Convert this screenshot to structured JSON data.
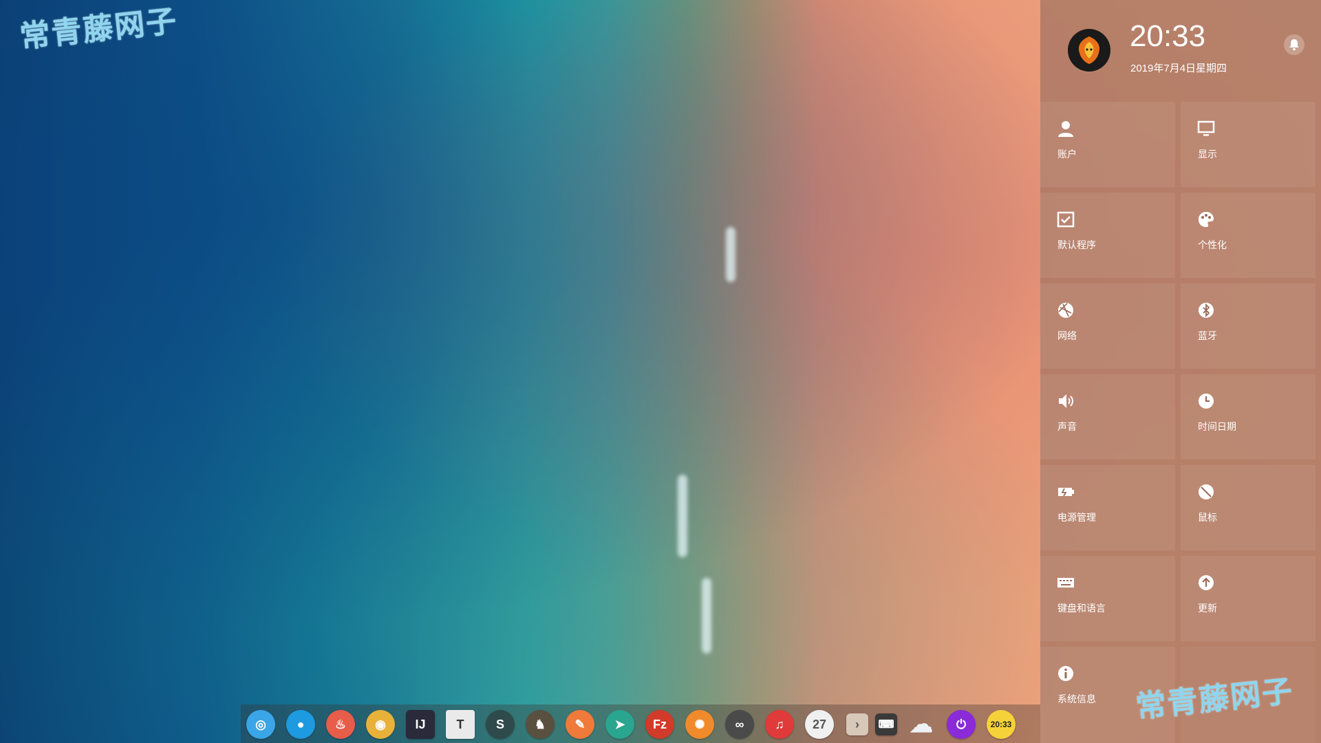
{
  "watermark": {
    "text": "常青藤网子"
  },
  "panel": {
    "clock": "20:33",
    "date": "2019年7月4日星期四",
    "tiles": [
      {
        "label": "账户",
        "icon": "user-icon"
      },
      {
        "label": "显示",
        "icon": "monitor-icon"
      },
      {
        "label": "默认程序",
        "icon": "default-apps-icon"
      },
      {
        "label": "个性化",
        "icon": "palette-icon"
      },
      {
        "label": "网络",
        "icon": "network-icon"
      },
      {
        "label": "蓝牙",
        "icon": "bluetooth-icon"
      },
      {
        "label": "声音",
        "icon": "speaker-icon"
      },
      {
        "label": "时间日期",
        "icon": "clock-icon"
      },
      {
        "label": "电源管理",
        "icon": "battery-icon"
      },
      {
        "label": "鼠标",
        "icon": "mouse-icon"
      },
      {
        "label": "键盘和语言",
        "icon": "keyboard-icon"
      },
      {
        "label": "更新",
        "icon": "update-icon"
      },
      {
        "label": "系统信息",
        "icon": "info-icon"
      }
    ]
  },
  "dock": {
    "items": [
      {
        "name": "launcher-icon",
        "color": "#3aa6e8",
        "glyph": "◎"
      },
      {
        "name": "deepin-store-icon",
        "color": "#1e9be0",
        "glyph": "●"
      },
      {
        "name": "security-icon",
        "color": "#e85c4a",
        "glyph": "♨"
      },
      {
        "name": "chrome-icon",
        "color": "#e8b23a",
        "glyph": "◉"
      },
      {
        "name": "intellij-icon",
        "color": "#2a2a3a",
        "glyph": "IJ"
      },
      {
        "name": "typora-icon",
        "color": "#eaeaea",
        "glyph": "T"
      },
      {
        "name": "s-app-icon",
        "color": "#2f4a4a",
        "glyph": "S"
      },
      {
        "name": "penguin-icon",
        "color": "#5a5040",
        "glyph": "♞"
      },
      {
        "name": "edit-tool-icon",
        "color": "#f07a3a",
        "glyph": "✎"
      },
      {
        "name": "telegram-icon",
        "color": "#2aa58f",
        "glyph": "➤"
      },
      {
        "name": "filezilla-icon",
        "color": "#d23a2a",
        "glyph": "Fz"
      },
      {
        "name": "settings-app-icon",
        "color": "#f08a2a",
        "glyph": "✺"
      },
      {
        "name": "infinity-app-icon",
        "color": "#4a4a4a",
        "glyph": "∞"
      },
      {
        "name": "music-icon",
        "color": "#e03a3a",
        "glyph": "♫"
      },
      {
        "name": "calendar-icon",
        "color": "#f0f0f0",
        "glyph": "27"
      },
      {
        "name": "expand-tray-icon",
        "color": "#d8c8b8",
        "glyph": "›"
      },
      {
        "name": "keyboard-tray-icon",
        "color": "#3a3a3a",
        "glyph": "⌨"
      },
      {
        "name": "weather-icon",
        "color": "#bfc9d6",
        "glyph": "☁"
      },
      {
        "name": "power-icon",
        "color": "#8a2ad8",
        "glyph": "⏻"
      },
      {
        "name": "clock-tray-icon",
        "color": "#f5d23a",
        "glyph": "20:33"
      }
    ]
  }
}
